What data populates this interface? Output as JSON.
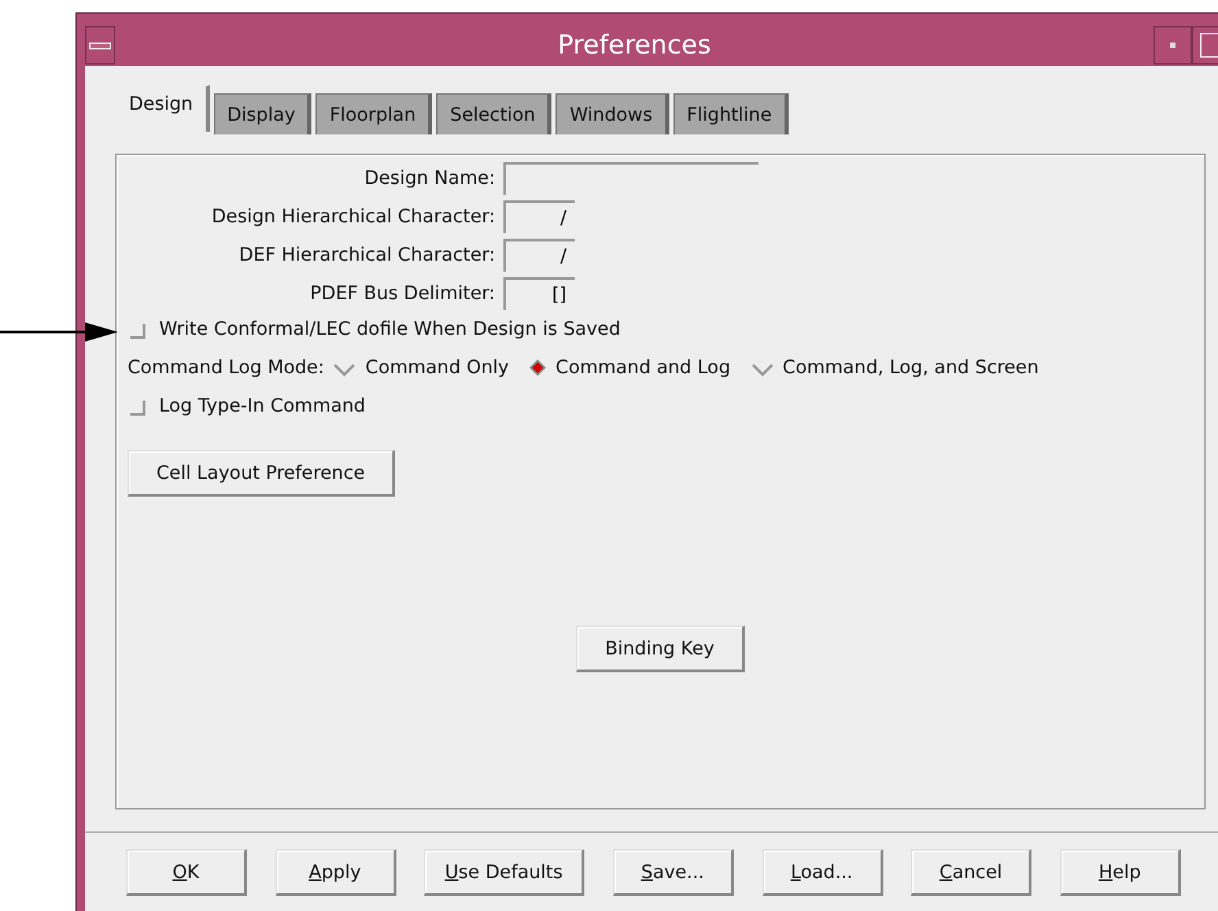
{
  "window": {
    "title": "Preferences"
  },
  "tabs": [
    {
      "label": "Design",
      "selected": true
    },
    {
      "label": "Display",
      "selected": false
    },
    {
      "label": "Floorplan",
      "selected": false
    },
    {
      "label": "Selection",
      "selected": false
    },
    {
      "label": "Windows",
      "selected": false
    },
    {
      "label": "Flightline",
      "selected": false
    }
  ],
  "fields": [
    {
      "label": "Design Name:",
      "kind": "wide"
    },
    {
      "label": "Design Hierarchical Character:",
      "value": "/",
      "kind": "short"
    },
    {
      "label": "DEF Hierarchical Character:",
      "value": "/",
      "kind": "short"
    },
    {
      "label": "PDEF Bus Delimiter:",
      "value": "[]",
      "kind": "short"
    }
  ],
  "write_dofile": {
    "label": "Write Conformal/LEC dofile When Design is Saved",
    "checked": false
  },
  "log_mode": {
    "label": "Command Log Mode:",
    "options": [
      {
        "label": "Command Only",
        "selected": false
      },
      {
        "label": "Command and Log",
        "selected": true
      },
      {
        "label": "Command, Log, and Screen",
        "selected": false
      }
    ]
  },
  "log_type_in": {
    "label": "Log Type-In Command",
    "checked": false
  },
  "cell_layout_button": "Cell Layout Preference",
  "binding_key_button": "Binding Key",
  "buttons": [
    {
      "key": "O",
      "rest": "K"
    },
    {
      "key": "A",
      "rest": "pply"
    },
    {
      "key": "U",
      "rest": "se Defaults"
    },
    {
      "key": "S",
      "rest": "ave..."
    },
    {
      "key": "L",
      "rest": "oad..."
    },
    {
      "key": "C",
      "rest": "ancel"
    },
    {
      "key": "H",
      "rest": "elp"
    }
  ]
}
